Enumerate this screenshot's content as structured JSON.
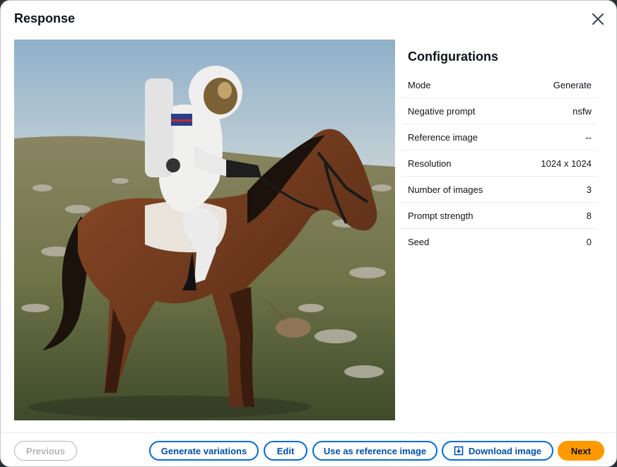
{
  "modal": {
    "title": "Response",
    "close_icon": "close-icon"
  },
  "image": {
    "subject": "astronaut-riding-horse"
  },
  "configurations": {
    "title": "Configurations",
    "rows": [
      {
        "label": "Mode",
        "value": "Generate"
      },
      {
        "label": "Negative prompt",
        "value": "nsfw"
      },
      {
        "label": "Reference image",
        "value": "--"
      },
      {
        "label": "Resolution",
        "value": "1024 x 1024"
      },
      {
        "label": "Number of images",
        "value": "3"
      },
      {
        "label": "Prompt strength",
        "value": "8"
      },
      {
        "label": "Seed",
        "value": "0"
      }
    ]
  },
  "footer": {
    "previous": "Previous",
    "generate_variations": "Generate variations",
    "edit": "Edit",
    "use_as_reference": "Use as reference image",
    "download": "Download image",
    "download_icon": "download-icon",
    "next": "Next"
  },
  "colors": {
    "primary_button": "#ff9900",
    "link_blue": "#006ce0",
    "disabled": "#b4b4bb"
  }
}
